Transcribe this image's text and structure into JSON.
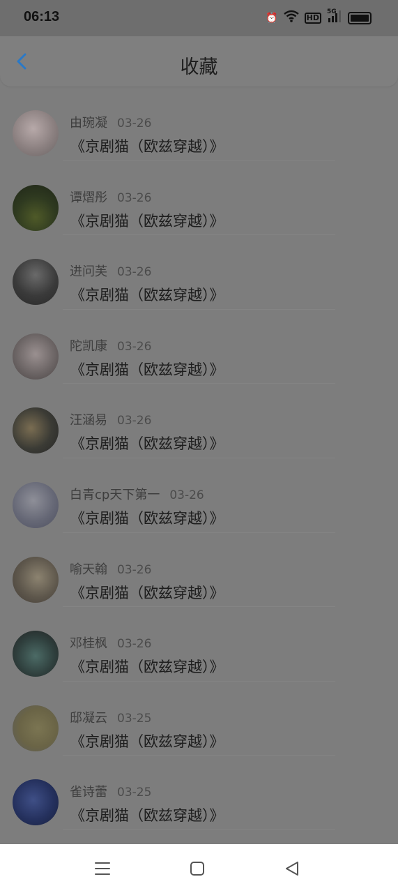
{
  "status": {
    "time": "06:13",
    "hd": "HD",
    "net": "5G"
  },
  "header": {
    "title": "收藏"
  },
  "items": [
    {
      "name": "由琬凝",
      "date": "03-26",
      "content": "《京剧猫（欧兹穿越）》"
    },
    {
      "name": "谭熠彤",
      "date": "03-26",
      "content": "《京剧猫（欧兹穿越）》"
    },
    {
      "name": "进问芙",
      "date": "03-26",
      "content": "《京剧猫（欧兹穿越）》"
    },
    {
      "name": "陀凯康",
      "date": "03-26",
      "content": "《京剧猫（欧兹穿越）》"
    },
    {
      "name": "汪涵易",
      "date": "03-26",
      "content": "《京剧猫（欧兹穿越）》"
    },
    {
      "name": "白青cp天下第一",
      "date": "03-26",
      "content": "《京剧猫（欧兹穿越）》"
    },
    {
      "name": "喻天翰",
      "date": "03-26",
      "content": "《京剧猫（欧兹穿越）》"
    },
    {
      "name": "邓桂枫",
      "date": "03-26",
      "content": "《京剧猫（欧兹穿越）》"
    },
    {
      "name": "邸凝云",
      "date": "03-25",
      "content": "《京剧猫（欧兹穿越）》"
    },
    {
      "name": "雀诗蕾",
      "date": "03-25",
      "content": "《京剧猫（欧兹穿越）》"
    }
  ],
  "colors": {
    "accent": "#2a79c7",
    "overlay": "#7d7d7d"
  },
  "nav": {
    "menu_icon": "menu-icon",
    "home_icon": "home-icon",
    "back_icon": "back-triangle-icon"
  }
}
